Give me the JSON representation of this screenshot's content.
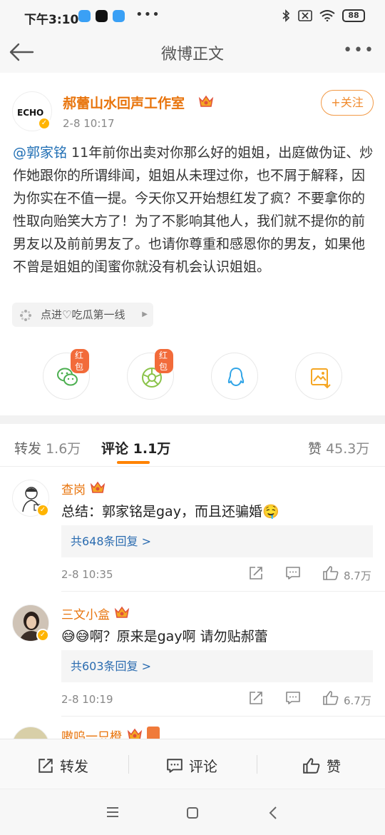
{
  "status_bar": {
    "time": "下午3:10",
    "battery": "88"
  },
  "nav": {
    "title": "微博正文",
    "more": "•••"
  },
  "post": {
    "author": "郝蕾山水回声工作室",
    "time": "2-8 10:17",
    "follow_label": "+关注",
    "mention": "@郭家铭",
    "body": " 11年前你出卖对你那么好的姐姐，出庭做伪证、炒作她跟你的所谓绯闻，姐姐从未理过你，也不屑于解释，因为你实在不值一提。今天你又开始想红发了疯？不要拿你的性取向贻笑大方了！为了不影响其他人，我们就不提你的前男友以及前前男友了。也请你尊重和感恩你的男友，如果他不曾是姐姐的闺蜜你就没有机会认识姐姐。",
    "topic": "点进♡吃瓜第一线",
    "avatar_text": "ECHO"
  },
  "share": {
    "badges": [
      "红包",
      "红包"
    ],
    "items": [
      "wechat-icon",
      "moments-icon",
      "qq-icon",
      "save-image-icon"
    ]
  },
  "tabs": {
    "repost_label": "转发",
    "repost_count": "1.6万",
    "comment_label": "评论",
    "comment_count": "1.1万",
    "like_label": "赞",
    "like_count": "45.3万"
  },
  "comments": [
    {
      "name": "查岗",
      "text": "总结：郭家铭是gay，而且还骗婚🤤",
      "replies": "共648条回复 >",
      "time": "2-8 10:35",
      "likes": "8.7万"
    },
    {
      "name": "三文小盒",
      "text": "😅😅啊？原来是gay啊 请勿贴郝蕾",
      "replies": "共603条回复 >",
      "time": "2-8 10:19",
      "likes": "6.7万"
    },
    {
      "name": "嗷呜一只橙"
    }
  ],
  "bottom_bar": {
    "repost": "转发",
    "comment": "评论",
    "like": "赞"
  },
  "colors": {
    "accent": "#ff8200",
    "name": "#e8740c",
    "link": "#1f6eb4"
  }
}
